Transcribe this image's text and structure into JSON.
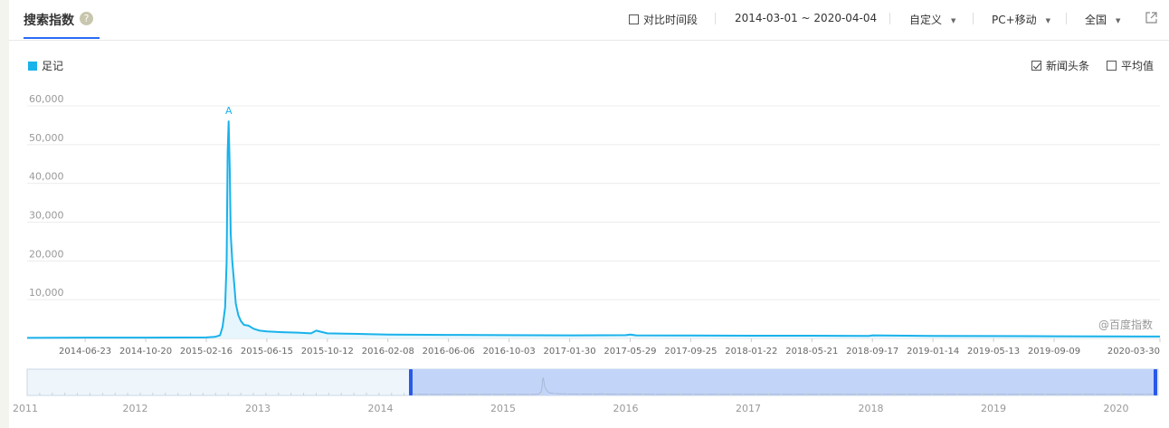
{
  "header": {
    "title": "搜索指数",
    "help_icon": "?",
    "compare_label": "对比时间段",
    "date_range": "2014-03-01 ~ 2020-04-04",
    "mode": "自定义",
    "device": "PC+移动",
    "region": "全国",
    "caret": "▼"
  },
  "legend": {
    "series_label": "足记",
    "series_color": "#19b2eb"
  },
  "options": {
    "news_label": "新闻头条",
    "news_checked": true,
    "avg_label": "平均值",
    "avg_checked": false
  },
  "watermark": "@百度指数",
  "peak_marker": "A",
  "chart_data": {
    "type": "area",
    "yticks": [
      "10,000",
      "20,000",
      "30,000",
      "40,000",
      "50,000",
      "60,000"
    ],
    "ylim": [
      0,
      60000
    ],
    "xticks": [
      "2014-06-23",
      "2014-10-20",
      "2015-02-16",
      "2015-06-15",
      "2015-10-12",
      "2016-02-08",
      "2016-06-06",
      "2016-10-03",
      "2017-01-30",
      "2017-05-29",
      "2017-09-25",
      "2018-01-22",
      "2018-05-21",
      "2018-09-17",
      "2019-01-14",
      "2019-05-13",
      "2019-09-09",
      "2020-03-30"
    ],
    "series": [
      {
        "name": "足记",
        "x": [
          "2014-03-01",
          "2014-06-23",
          "2014-10-20",
          "2015-02-16",
          "2015-03-05",
          "2015-03-15",
          "2015-03-20",
          "2015-03-25",
          "2015-03-28",
          "2015-03-30",
          "2015-04-01",
          "2015-04-03",
          "2015-04-05",
          "2015-04-08",
          "2015-04-12",
          "2015-04-15",
          "2015-04-20",
          "2015-04-25",
          "2015-05-01",
          "2015-05-10",
          "2015-05-20",
          "2015-06-01",
          "2015-06-15",
          "2015-07-15",
          "2015-08-15",
          "2015-09-10",
          "2015-09-20",
          "2015-10-12",
          "2015-12-01",
          "2016-02-08",
          "2016-06-06",
          "2016-10-03",
          "2017-01-30",
          "2017-05-20",
          "2017-05-29",
          "2017-06-10",
          "2017-09-25",
          "2018-01-22",
          "2018-05-21",
          "2018-09-10",
          "2018-09-17",
          "2019-01-14",
          "2019-05-13",
          "2019-09-09",
          "2020-03-30",
          "2020-04-04"
        ],
        "values": [
          150,
          200,
          200,
          250,
          400,
          800,
          3000,
          8000,
          20000,
          48000,
          56000,
          44000,
          27000,
          20000,
          14000,
          9000,
          6000,
          4500,
          3500,
          3300,
          2500,
          2000,
          1800,
          1600,
          1500,
          1300,
          2000,
          1300,
          1200,
          1000,
          900,
          850,
          800,
          850,
          1000,
          800,
          750,
          700,
          700,
          650,
          800,
          650,
          600,
          550,
          500,
          500
        ]
      }
    ]
  },
  "navigator": {
    "years": [
      "2011",
      "2012",
      "2013",
      "2014",
      "2015",
      "2016",
      "2017",
      "2018",
      "2019",
      "2020"
    ]
  }
}
